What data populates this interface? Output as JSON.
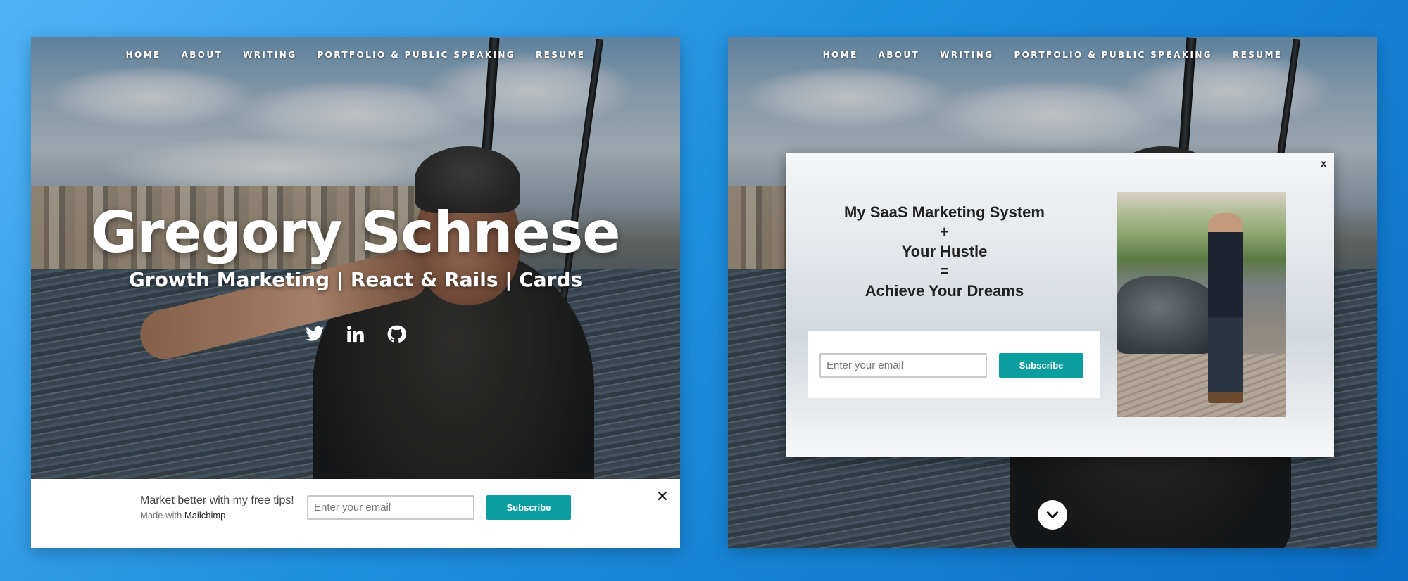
{
  "left_site": {
    "nav": [
      {
        "label": "HOME"
      },
      {
        "label": "ABOUT"
      },
      {
        "label": "WRITING"
      },
      {
        "label": "PORTFOLIO & PUBLIC SPEAKING"
      },
      {
        "label": "RESUME"
      }
    ],
    "hero": {
      "title": "Gregory Schnese",
      "subtitle": "Growth Marketing | React & Rails | Cards"
    },
    "socials": [
      {
        "icon": "twitter-icon"
      },
      {
        "icon": "linkedin-icon"
      },
      {
        "icon": "github-icon"
      }
    ],
    "mailchimp_bar": {
      "headline": "Market better with my free tips!",
      "made_with": "Made with",
      "made_with_brand": "Mailchimp",
      "email_placeholder": "Enter your email",
      "subscribe_label": "Subscribe",
      "close_label": "✕"
    }
  },
  "right_site": {
    "nav": [
      {
        "label": "HOME"
      },
      {
        "label": "ABOUT"
      },
      {
        "label": "WRITING"
      },
      {
        "label": "PORTFOLIO & PUBLIC SPEAKING"
      },
      {
        "label": "RESUME"
      }
    ],
    "modal": {
      "close_label": "x",
      "heading_lines": [
        "My SaaS Marketing System",
        "+",
        "Your Hustle",
        "=",
        "Achieve Your Dreams"
      ],
      "email_placeholder": "Enter your email",
      "subscribe_label": "Subscribe"
    },
    "scroll_icon": "chevron-down-icon"
  },
  "colors": {
    "accent": "#0b9ea1",
    "background_start": "#4fb3f6",
    "background_end": "#0a6fc6"
  }
}
